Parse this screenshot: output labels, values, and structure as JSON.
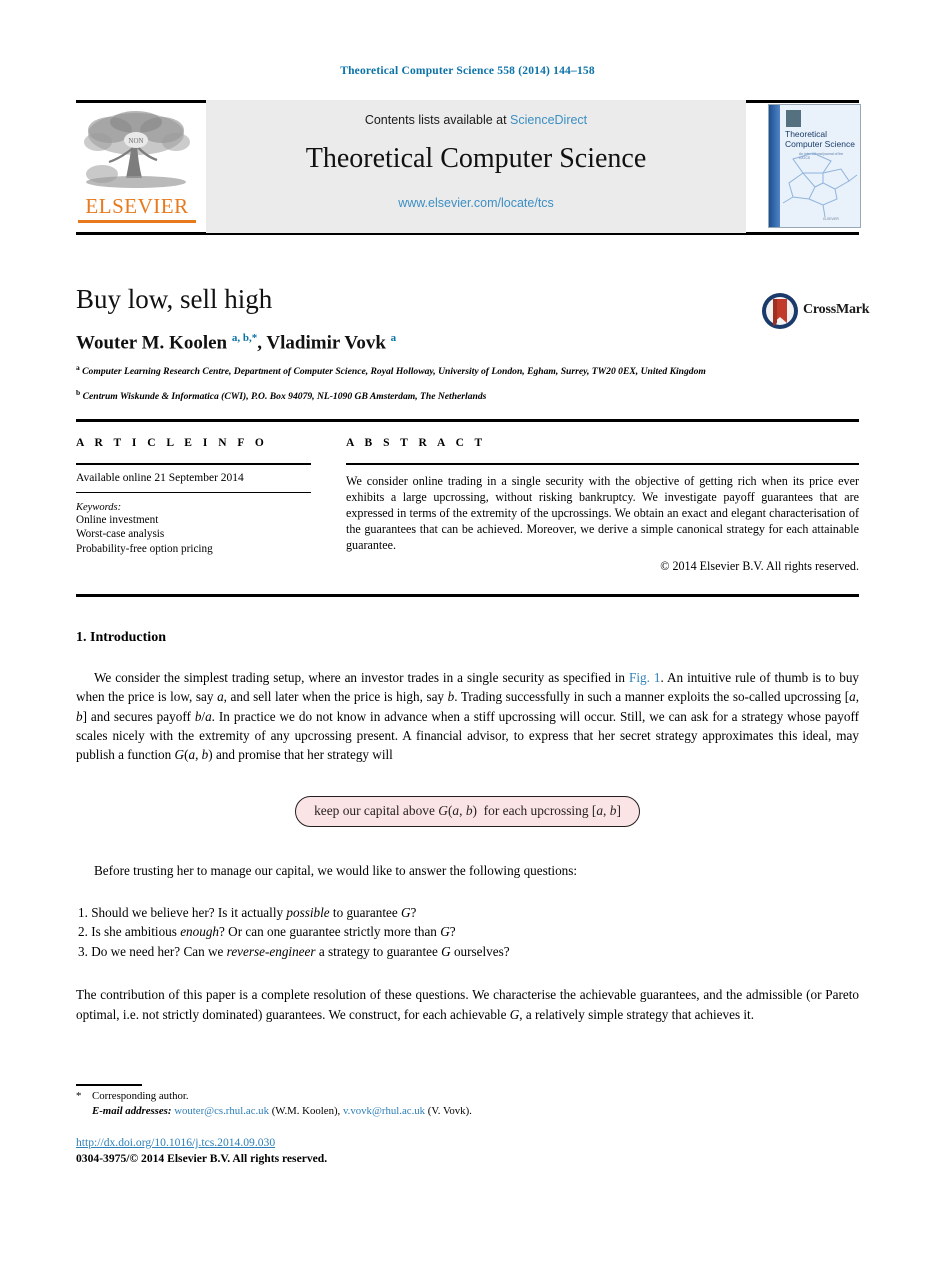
{
  "running_head": "Theoretical Computer Science 558 (2014) 144–158",
  "masthead": {
    "contents_prefix": "Contents lists available at ",
    "sciencedirect_link": "ScienceDirect",
    "journal_title": "Theoretical Computer Science",
    "journal_url": "www.elsevier.com/locate/tcs",
    "publisher_wordmark": "ELSEVIER",
    "publisher_logo_icon": "elsevier-tree-icon",
    "cover": {
      "title_line1": "Theoretical",
      "title_line2": "Computer Science",
      "subtitle": "An international journal of the EATCS",
      "footer": "ELSEVIER"
    }
  },
  "article": {
    "title": "Buy low, sell high",
    "authors_html": "Wouter M. Koolen <sup>a, b,*</sup>, Vladimir Vovk <sup>a</sup>",
    "affiliation_a": "Computer Learning Research Centre, Department of Computer Science, Royal Holloway, University of London, Egham, Surrey, TW20 0EX, United Kingdom",
    "affiliation_b": "Centrum Wiskunde & Informatica (CWI), P.O. Box 94079, NL-1090 GB Amsterdam, The Netherlands",
    "crossmark_label": "CrossMark",
    "crossmark_icon": "crossmark-icon"
  },
  "article_info": {
    "heading": "A R T I C L E   I N F O",
    "available_online": "Available online 21 September 2014",
    "keywords_label": "Keywords:",
    "keywords": [
      "Online investment",
      "Worst-case analysis",
      "Probability-free option pricing"
    ]
  },
  "abstract": {
    "heading": "A B S T R A C T",
    "text": "We consider online trading in a single security with the objective of getting rich when its price ever exhibits a large upcrossing, without risking bankruptcy. We investigate payoff guarantees that are expressed in terms of the extremity of the upcrossings. We obtain an exact and elegant characterisation of the guarantees that can be achieved. Moreover, we derive a simple canonical strategy for each attainable guarantee.",
    "copyright": "© 2014 Elsevier B.V. All rights reserved."
  },
  "body": {
    "section_heading": "1. Introduction",
    "para1_html": "<span class=\"indent\"></span>We consider the simplest trading setup, where an investor trades in a single security as specified in <a class=\"lnk\" href=\"#\">Fig. 1</a>. An intuitive rule of thumb is to buy when the price is low, say <em>a</em>, and sell later when the price is high, say <em>b</em>. Trading successfully in such a manner exploits the so-called upcrossing [<em>a</em>, <em>b</em>] and secures payoff <em>b</em>/<em>a</em>. In practice we do not know in advance when a stiff upcrossing will occur. Still, we can ask for a strategy whose payoff scales nicely with the extremity of any upcrossing present. A financial advisor, to express that her secret strategy approximates this ideal, may publish a function <em>G</em>(<em>a</em>, <em>b</em>) and promise that her strategy will",
    "boxed_formula_html": "keep our capital above <i>G</i>(<i>a</i>, <i>b</i>)&nbsp; for each upcrossing [<i>a</i>, <i>b</i>]",
    "para2_html": "<span class=\"indent\"></span>Before trusting her to manage our capital, we would like to answer the following questions:",
    "questions_html": [
      "1. Should we believe her? Is it actually <em>possible</em> to guarantee <em>G</em>?",
      "2. Is she ambitious <em>enough</em>? Or can one guarantee strictly more than <em>G</em>?",
      "3. Do we need her? Can we <em>reverse-engineer</em> a strategy to guarantee <em>G</em> ourselves?"
    ],
    "para3_html": "The contribution of this paper is a complete resolution of these questions. We characterise the achievable guarantees, and the admissible (or Pareto optimal, i.e. not strictly dominated) guarantees. We construct, for each achievable <em>G</em>, a relatively simple strategy that achieves it."
  },
  "footer": {
    "corresponding_author": "Corresponding author.",
    "email_label": "E-mail addresses:",
    "email1": "wouter@cs.rhul.ac.uk",
    "email1_name": "(W.M. Koolen),",
    "email2": "v.vovk@rhul.ac.uk",
    "email2_name": "(V. Vovk).",
    "doi": "http://dx.doi.org/10.1016/j.tcs.2014.09.030",
    "issn_line": "0304-3975/© 2014 Elsevier B.V. All rights reserved."
  },
  "colors": {
    "link_blue": "#2e7fb8",
    "running_head_blue": "#0b72a8",
    "elsevier_orange": "#e87a1e",
    "band_gray": "#ebebeb",
    "box_pink": "#fbe4e6",
    "crossmark_blue": "#1a3a6b",
    "crossmark_red": "#c0392b"
  }
}
